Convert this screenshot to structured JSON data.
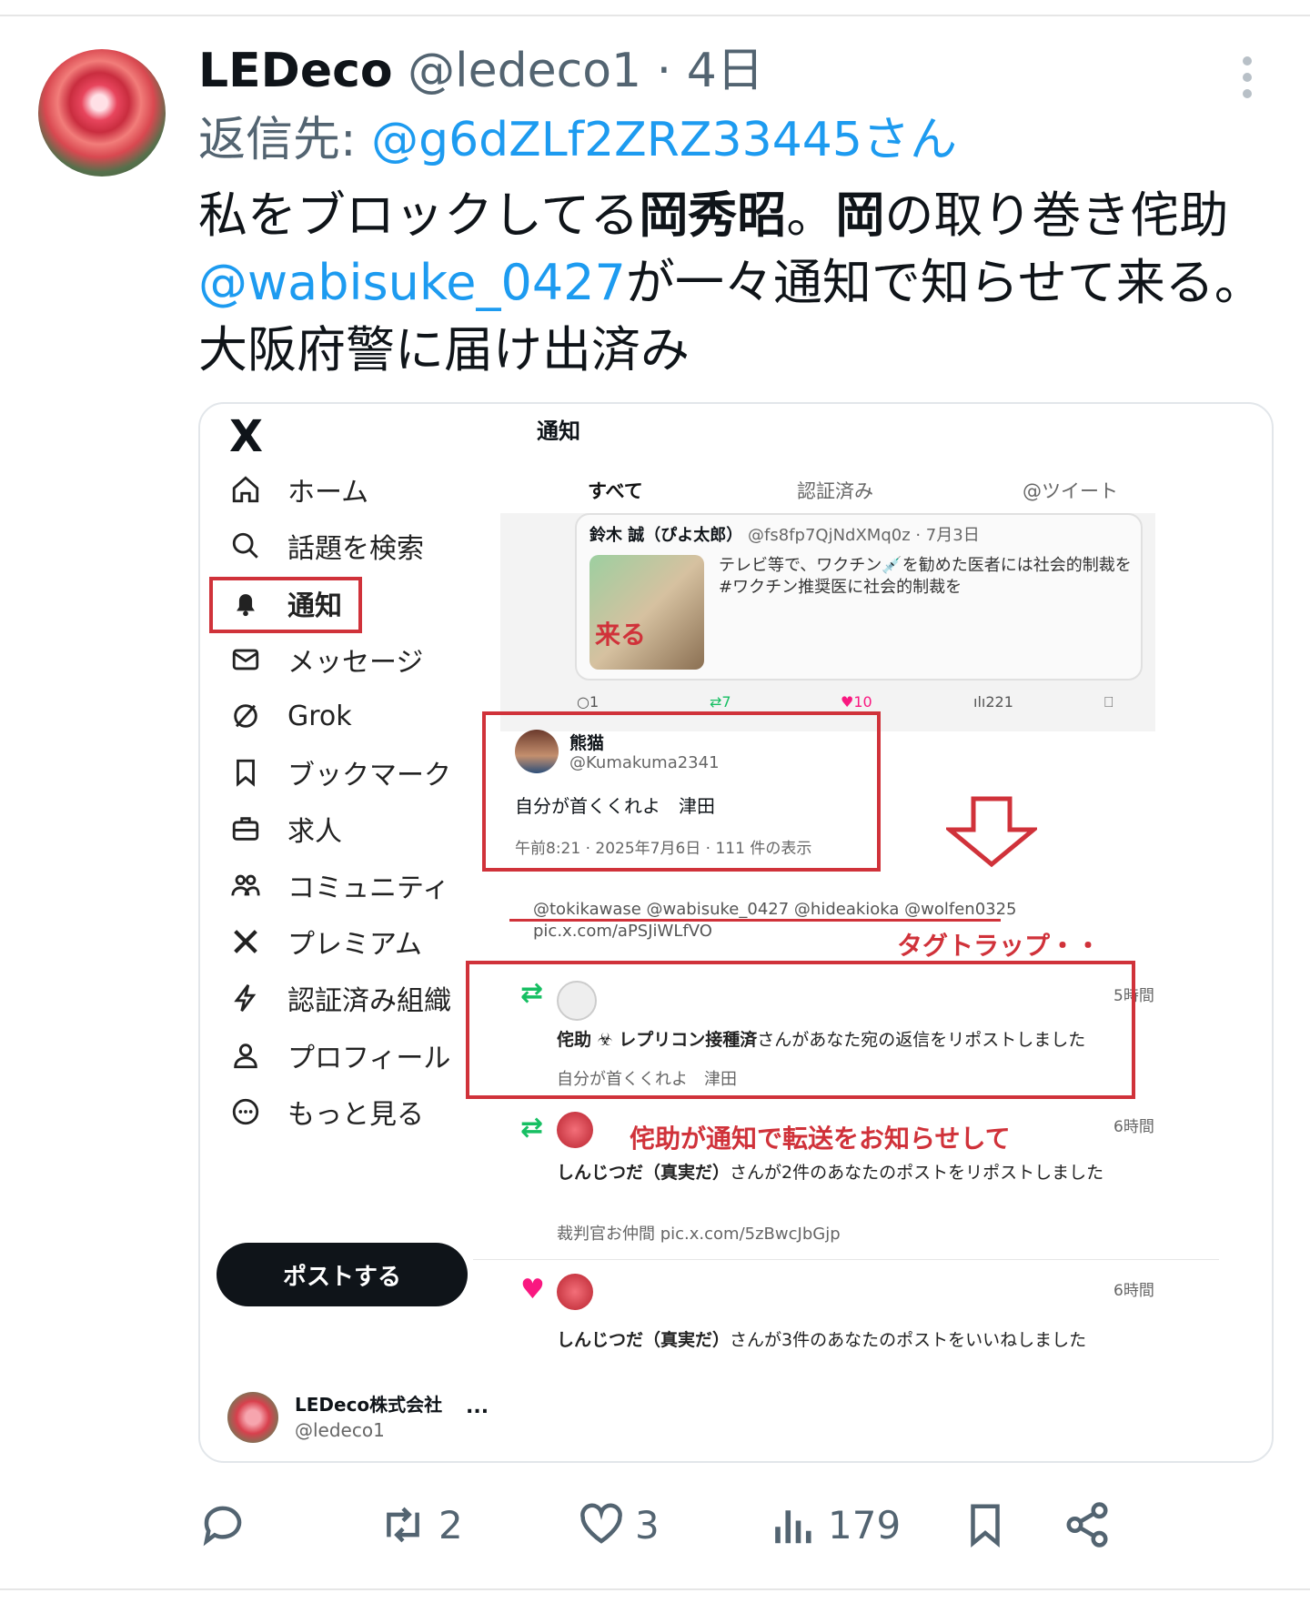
{
  "tweet": {
    "display_name": "LEDeco",
    "handle": "@ledeco1",
    "separator": "·",
    "time": "4日",
    "reply_prefix": "返信先: ",
    "reply_to": "@g6dZLf2ZRZ33445さん",
    "body_part1": "私をブロックしてる",
    "body_bold1": "岡秀昭",
    "body_part2": "。",
    "body_bold2": "岡",
    "body_part3": "の取り巻き侘助",
    "body_mention": "@wabisuke_0427",
    "body_part4": "が一々通知で知らせて来る。",
    "body_part5": "大阪府警に届け出済み"
  },
  "embedded": {
    "sidebar": {
      "logo": "X",
      "items": [
        {
          "label": "ホーム",
          "icon": "home-icon"
        },
        {
          "label": "話題を検索",
          "icon": "search-icon"
        },
        {
          "label": "通知",
          "icon": "bell-icon"
        },
        {
          "label": "メッセージ",
          "icon": "mail-icon"
        },
        {
          "label": "Grok",
          "icon": "grok-icon"
        },
        {
          "label": "ブックマーク",
          "icon": "bookmark-icon"
        },
        {
          "label": "求人",
          "icon": "briefcase-icon"
        },
        {
          "label": "コミュニティ",
          "icon": "community-icon"
        },
        {
          "label": "プレミアム",
          "icon": "x-premium-icon"
        },
        {
          "label": "認証済み組織",
          "icon": "lightning-icon"
        },
        {
          "label": "プロフィール",
          "icon": "person-icon"
        },
        {
          "label": "もっと見る",
          "icon": "more-circle-icon"
        }
      ],
      "post_button": "ポストする",
      "account_name": "LEDeco株式会社",
      "account_handle": "@ledeco1",
      "account_more": "..."
    },
    "header": "通知",
    "tabs": [
      "すべて",
      "認証済み",
      "@ツイート"
    ],
    "quoted": {
      "name": "鈴木 誠（ぴよ太郎）",
      "meta": "@fs8fp7QjNdXMq0z · 7月3日",
      "image_label": "来る",
      "text": "テレビ等で、ワクチン💉を勧めた医者には社会的制裁を\n#ワクチン推奨医に社会的制裁を",
      "replies": "1",
      "retweets": "7",
      "likes": "10",
      "views": "221"
    },
    "kuma": {
      "name": "熊猫",
      "handle": "@Kumakuma2341",
      "text": "自分が首くくれよ　津田",
      "meta": "午前8:21 · 2025年7月6日 · 111 件の表示"
    },
    "tags_line1": "@tokikawase @wabisuke_0427 @hideakioka @wolfen0325",
    "tags_line2": "pic.x.com/aPSJiWLfVO",
    "tag_trap": "タグトラップ・・",
    "notif1": {
      "time": "5時間",
      "actor": "侘助 ☣ レプリコン接種済",
      "action": "さんがあなた宛の返信をリポストしました",
      "sub": "自分が首くくれよ　津田"
    },
    "annotation": "侘助が通知で転送をお知らせして",
    "notif2": {
      "time": "6時間",
      "actor": "しんじつだ（真実だ）",
      "action": "さんが2件のあなたのポストをリポストしました",
      "sub": "裁判官お仲間 pic.x.com/5zBwcJbGjp"
    },
    "notif3": {
      "time": "6時間",
      "actor": "しんじつだ（真実だ）",
      "action": "さんが3件のあなたのポストをいいねしました"
    }
  },
  "actions": {
    "reply_count": "",
    "retweet_count": "2",
    "like_count": "3",
    "view_count": "179"
  },
  "colors": {
    "link": "#1d9bf0",
    "text": "#0f1419",
    "muted": "#536471",
    "annotation_red": "#d0323a",
    "retweet_green": "#17bf63",
    "like_pink": "#f91880"
  }
}
